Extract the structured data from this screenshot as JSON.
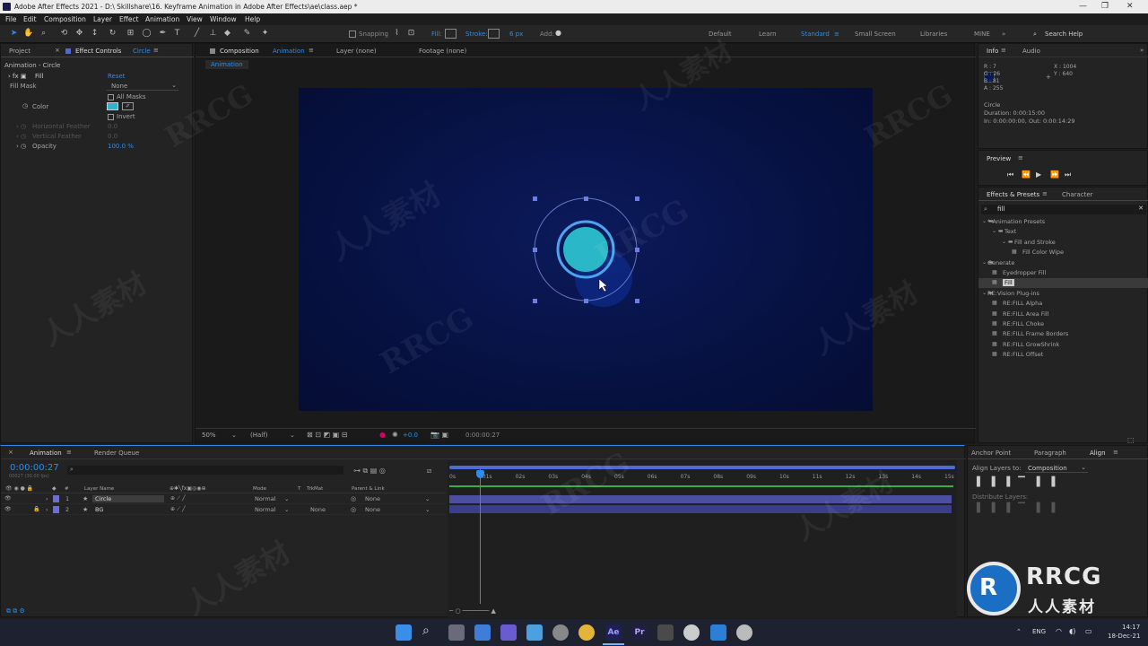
{
  "titlebar": {
    "title": "Adobe After Effects 2021 - D:\\ Skillshare\\16. Keyframe Animation in Adobe After Effects\\ae\\class.aep *"
  },
  "menu": [
    "File",
    "Edit",
    "Composition",
    "Layer",
    "Effect",
    "Animation",
    "View",
    "Window",
    "Help"
  ],
  "toolbar": {
    "snapping": "Snapping",
    "fill": "Fill:",
    "stroke": "Stroke:",
    "stroke_px": "6 px",
    "add": "Add:",
    "search": "Search Help"
  },
  "workspaces": [
    "Default",
    "Learn",
    "Standard",
    "Small Screen",
    "Libraries",
    "MINE"
  ],
  "left_panel": {
    "tab_project": "Project",
    "tab_effect_controls": "Effect Controls",
    "tab_effect_target": "Circle",
    "context": "Animation - Circle",
    "effect": "Fill",
    "reset": "Reset",
    "fill_mask_label": "Fill Mask",
    "fill_mask_value": "None",
    "all_masks": "All Masks",
    "color_label": "Color",
    "invert": "Invert",
    "h_feather": "Horizontal Feather",
    "h_feather_val": "0.0",
    "v_feather": "Vertical Feather",
    "v_feather_val": "0.0",
    "opacity": "Opacity",
    "opacity_val": "100.0 %",
    "color_hex": "#2ab8c8"
  },
  "comp_panel": {
    "tab": "Composition",
    "tab_name": "Animation",
    "layer": "Layer (none)",
    "footage": "Footage (none)",
    "subtab": "Animation",
    "zoom": "50%",
    "res": "(Half)",
    "exposure": "+0.0",
    "time": "0:00:00:27"
  },
  "info": {
    "tab": "Info",
    "tab2": "Audio",
    "r": "R : 7",
    "g": "G : 26",
    "b": "B : 81",
    "a": "A : 255",
    "x": "X : 1004",
    "y": "Y : 640",
    "name": "Circle",
    "duration": "Duration: 0:00:15:00",
    "inout": "In: 0:00:00:00, Out: 0:00:14:29"
  },
  "preview": {
    "title": "Preview"
  },
  "effects": {
    "tab": "Effects & Presets",
    "tab2": "Character",
    "search": "fill",
    "items": [
      {
        "label": "* Animation Presets",
        "indent": 0
      },
      {
        "label": "Text",
        "indent": 1
      },
      {
        "label": "Fill and Stroke",
        "indent": 2
      },
      {
        "label": "Fill Color Wipe",
        "indent": 3
      },
      {
        "label": "Generate",
        "indent": 0
      },
      {
        "label": "Eyedropper Fill",
        "indent": 1
      },
      {
        "label": "Fill",
        "indent": 1,
        "selected": true
      },
      {
        "label": "RE:Vision Plug-ins",
        "indent": 0
      },
      {
        "label": "RE:FILL Alpha",
        "indent": 1
      },
      {
        "label": "RE:FILL Area Fill",
        "indent": 1
      },
      {
        "label": "RE:FILL Choke",
        "indent": 1
      },
      {
        "label": "RE:FILL Frame Borders",
        "indent": 1
      },
      {
        "label": "RE:FILL GrowShrink",
        "indent": 1
      },
      {
        "label": "RE:FILL Offset",
        "indent": 1
      }
    ]
  },
  "timeline": {
    "tab": "Animation",
    "tab2": "Render Queue",
    "timecode": "0:00:00:27",
    "fps": "00027 (30.00 fps)",
    "col_name": "Layer Name",
    "col_mode": "Mode",
    "col_t": "T",
    "col_trkmat": "TrkMat",
    "col_parent": "Parent & Link",
    "layers": [
      {
        "num": "1",
        "name": "Circle",
        "mode": "Normal",
        "trkmat": "",
        "parent": "None",
        "color": "#6d6dd8"
      },
      {
        "num": "2",
        "name": "BG",
        "mode": "Normal",
        "trkmat": "None",
        "parent": "None",
        "color": "#6d6dd8"
      }
    ],
    "ticks": [
      "0s",
      "01s",
      "02s",
      "03s",
      "04s",
      "05s",
      "06s",
      "07s",
      "08s",
      "09s",
      "10s",
      "11s",
      "12s",
      "13s",
      "14s",
      "15s"
    ]
  },
  "align": {
    "tab": "Align",
    "tab0": "Anchor Point",
    "tab1": "Paragraph",
    "align_to": "Align Layers to:",
    "align_val": "Composition",
    "distribute": "Distribute Layers:"
  },
  "taskbar": {
    "lang": "ENG",
    "time": "14:17",
    "date": "18-Dec-21"
  },
  "watermark": {
    "brand": "RRCG",
    "sub": "人人素材"
  }
}
